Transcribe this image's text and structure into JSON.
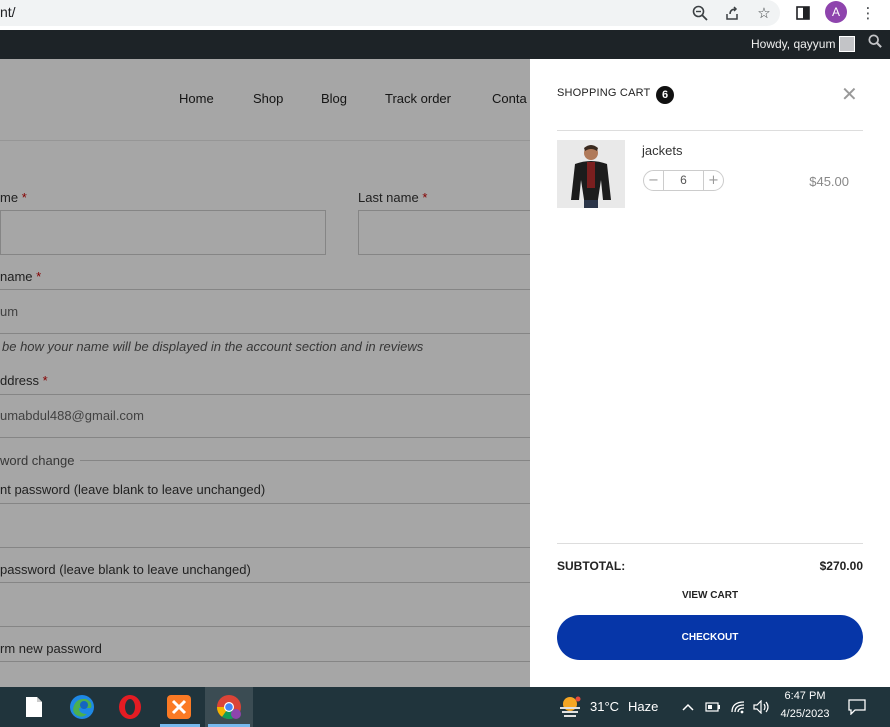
{
  "browser": {
    "url_text": "nt/",
    "avatar_letter": "A"
  },
  "adminbar": {
    "greeting": "Howdy, qayyum"
  },
  "nav": {
    "items": [
      "Home",
      "Shop",
      "Blog",
      "Track order",
      "Conta"
    ]
  },
  "form": {
    "first_name_label": "me",
    "last_name_label": "Last name",
    "display_name_label": "name",
    "display_name_value": "um",
    "display_hint": "be how your name will be displayed in the account section and in reviews",
    "email_label": "ddress",
    "email_value": "umabdul488@gmail.com",
    "password_legend": "word change",
    "current_pw_label": "nt password (leave blank to leave unchanged)",
    "new_pw_label": "password (leave blank to leave unchanged)",
    "confirm_pw_label": "rm new password",
    "required_mark": "*"
  },
  "cart": {
    "title": "SHOPPING CART",
    "count": "6",
    "close_glyph": "✕",
    "item": {
      "name": "jackets",
      "quantity": "6",
      "price": "$45.00",
      "minus": "−",
      "plus": "+"
    },
    "subtotal_label": "SUBTOTAL:",
    "subtotal_value": "$270.00",
    "view_cart": "VIEW CART",
    "checkout": "CHECKOUT",
    "checkout_color": "#0636a8"
  },
  "taskbar": {
    "weather_temp": "31°C",
    "weather_desc": "Haze",
    "time": "6:47 PM",
    "date": "4/25/2023"
  }
}
